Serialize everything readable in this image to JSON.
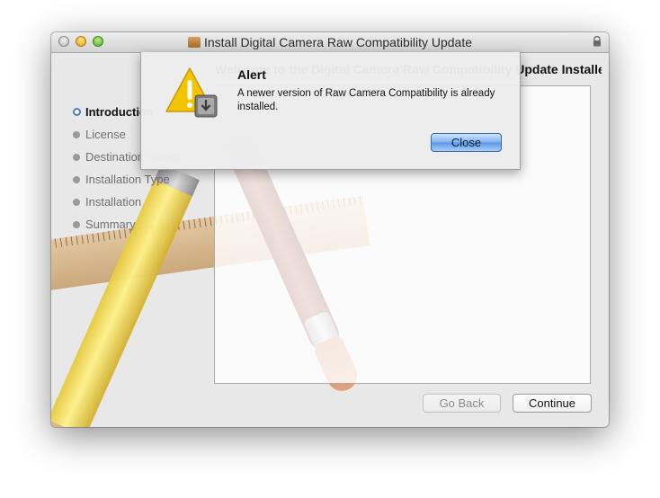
{
  "window": {
    "title": "Install Digital Camera Raw Compatibility Update",
    "header_text": "Welcome to the Digital Camera Raw Compatibility Update Installer"
  },
  "sidebar": {
    "steps": [
      {
        "label": "Introduction",
        "active": true
      },
      {
        "label": "License",
        "active": false
      },
      {
        "label": "Destination Select",
        "active": false
      },
      {
        "label": "Installation Type",
        "active": false
      },
      {
        "label": "Installation",
        "active": false
      },
      {
        "label": "Summary",
        "active": false
      }
    ]
  },
  "buttons": {
    "go_back": "Go Back",
    "continue": "Continue"
  },
  "alert": {
    "title": "Alert",
    "message": "A newer version of Raw Camera Compatibility is already installed.",
    "close": "Close"
  },
  "icons": {
    "package": "package-icon",
    "lock": "lock-icon",
    "alert": "warning-installer-icon"
  }
}
